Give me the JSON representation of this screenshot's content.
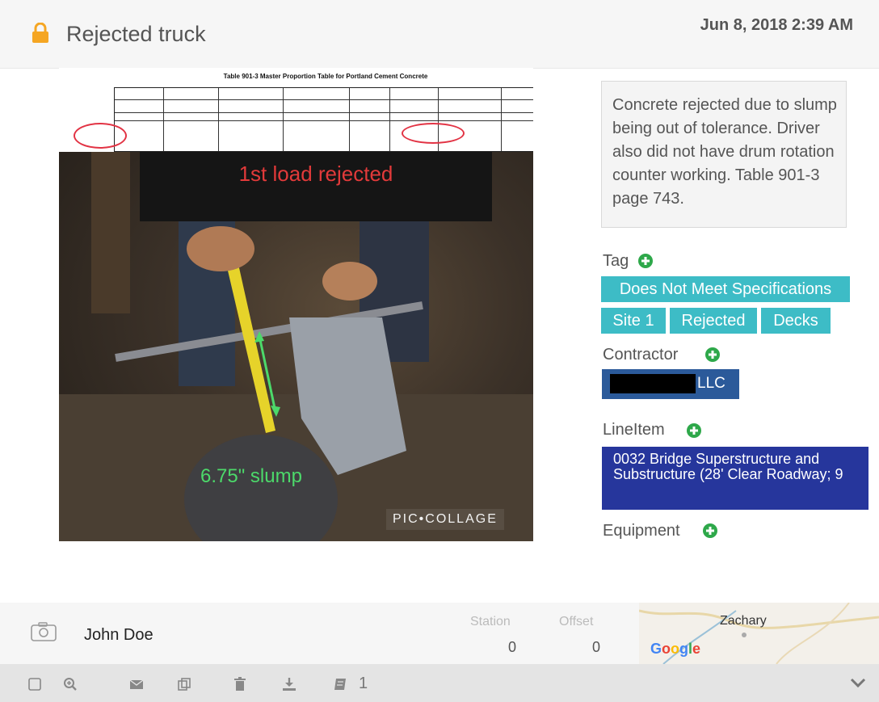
{
  "header": {
    "title": "Rejected truck",
    "timestamp": "Jun 8, 2018 2:39 AM",
    "lock_icon": "lock-icon"
  },
  "photo": {
    "doc_title": "Table 901-3 Master Proportion Table for Portland Cement Concrete",
    "banner_text": "1st load rejected",
    "slump_text": "6.75\" slump",
    "watermark": "PIC•COLLAGE"
  },
  "note": {
    "text": "Concrete rejected due to slump being out of tolerance. Driver also did not have drum rotation counter working. Table 901-3 page 743."
  },
  "tag_section": {
    "label": "Tag",
    "tags": [
      "Does Not Meet Specifications",
      "Site 1",
      "Rejected",
      "Decks"
    ]
  },
  "contractor_section": {
    "label": "Contractor",
    "value_suffix": "LLC"
  },
  "lineitem_section": {
    "label": "LineItem",
    "value": "0032 Bridge Superstructure and Substructure (28' Clear Roadway; 9"
  },
  "equipment_section": {
    "label": "Equipment"
  },
  "info": {
    "author": "John Doe",
    "station_label": "Station",
    "station_value": "0",
    "offset_label": "Offset",
    "offset_value": "0"
  },
  "map": {
    "city": "Zachary",
    "brand": "Google"
  },
  "toolbar": {
    "attachment_count": "1"
  },
  "colors": {
    "accent_orange": "#f5a623",
    "tag_teal": "#3dbcc6",
    "contractor_blue": "#2b5a9a",
    "lineitem_navy": "#26369c",
    "plus_green": "#2ea84a"
  }
}
